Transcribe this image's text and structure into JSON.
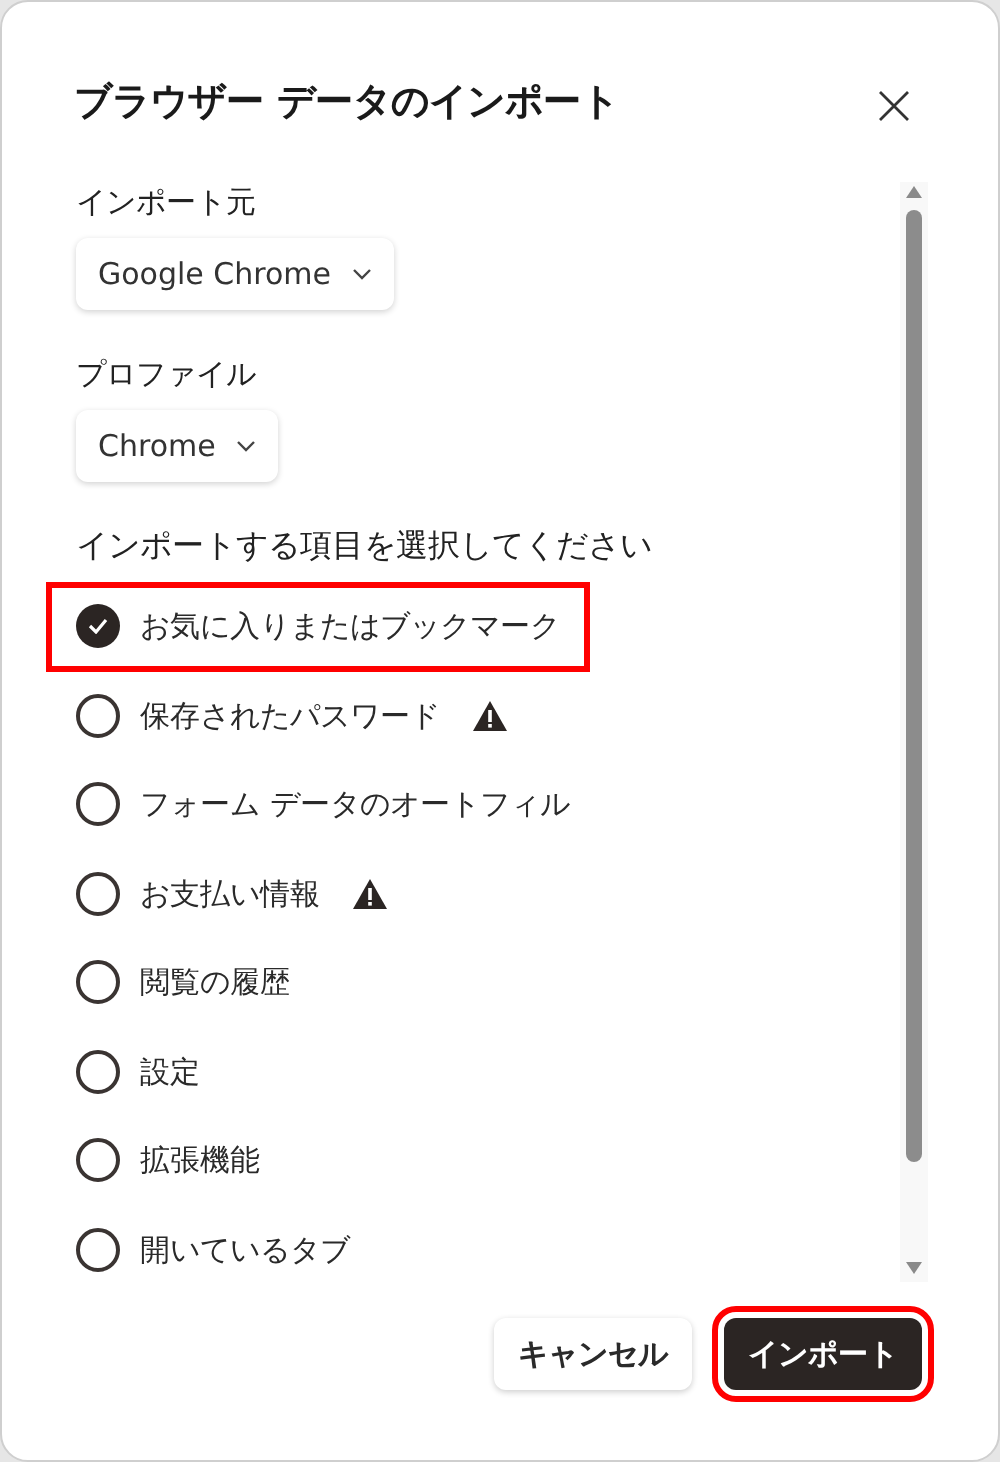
{
  "dialog": {
    "title": "ブラウザー データのインポート",
    "source": {
      "label": "インポート元",
      "value": "Google Chrome"
    },
    "profile": {
      "label": "プロファイル",
      "value": "Chrome"
    },
    "items_heading": "インポートする項目を選択してください",
    "items": [
      {
        "label": "お気に入りまたはブックマーク",
        "checked": true,
        "warning": false,
        "highlighted": true
      },
      {
        "label": "保存されたパスワード",
        "checked": false,
        "warning": true,
        "highlighted": false
      },
      {
        "label": "フォーム データのオートフィル",
        "checked": false,
        "warning": false,
        "highlighted": false
      },
      {
        "label": "お支払い情報",
        "checked": false,
        "warning": true,
        "highlighted": false
      },
      {
        "label": "閲覧の履歴",
        "checked": false,
        "warning": false,
        "highlighted": false
      },
      {
        "label": "設定",
        "checked": false,
        "warning": false,
        "highlighted": false
      },
      {
        "label": "拡張機能",
        "checked": false,
        "warning": false,
        "highlighted": false
      },
      {
        "label": "開いているタブ",
        "checked": false,
        "warning": false,
        "highlighted": false
      }
    ],
    "buttons": [
      {
        "label": "キャンセル",
        "kind": "secondary",
        "highlighted": false
      },
      {
        "label": "インポート",
        "kind": "primary",
        "highlighted": true
      }
    ]
  }
}
